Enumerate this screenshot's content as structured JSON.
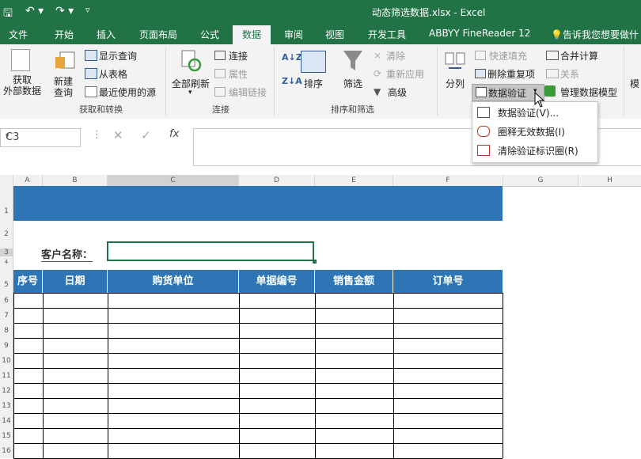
{
  "window": {
    "title": "动态筛选数据.xlsx - Excel"
  },
  "tabs": [
    {
      "label": "文件"
    },
    {
      "label": "开始"
    },
    {
      "label": "插入"
    },
    {
      "label": "页面布局"
    },
    {
      "label": "公式"
    },
    {
      "label": "数据"
    },
    {
      "label": "审阅"
    },
    {
      "label": "视图"
    },
    {
      "label": "开发工具"
    },
    {
      "label": "ABBYY FineReader 12"
    }
  ],
  "tell_me": "告诉我您想要做什",
  "ribbon": {
    "get_external": "获取\n外部数据",
    "new_query": "新建\n查询",
    "show_query": "显示查询",
    "from_table": "从表格",
    "recent_sources": "最近使用的源",
    "group_get": "获取和转换",
    "refresh_all": "全部刷新",
    "connections": "连接",
    "properties": "属性",
    "edit_links": "编辑链接",
    "group_conn": "连接",
    "sort": "排序",
    "filter": "筛选",
    "clear": "清除",
    "reapply": "重新应用",
    "advanced": "高级",
    "group_sort": "排序和筛选",
    "text_to_columns": "分列",
    "flash_fill": "快速填充",
    "remove_dup": "删除重复项",
    "data_validation": "数据验证",
    "consolidate": "合并计算",
    "relationships": "关系",
    "manage_model": "管理数据模型",
    "overflow": "模"
  },
  "dropdown": [
    {
      "label": "数据验证(V)..."
    },
    {
      "label": "圈释无效数据(I)"
    },
    {
      "label": "清除验证标识圈(R)"
    }
  ],
  "namebox": "C3",
  "columns": [
    "A",
    "B",
    "C",
    "D",
    "E",
    "F",
    "G",
    "H"
  ],
  "rows": [
    "1",
    "2",
    "3",
    "4",
    "5",
    "6",
    "7",
    "8",
    "9",
    "10",
    "11",
    "12",
    "13",
    "14",
    "15",
    "16"
  ],
  "sheet": {
    "customer_label": "客户名称：",
    "headers": [
      "序号",
      "日期",
      "购货单位",
      "单据编号",
      "销售金额",
      "订单号"
    ]
  },
  "colors": {
    "excel_green": "#217346",
    "header_blue": "#2e75b6"
  }
}
